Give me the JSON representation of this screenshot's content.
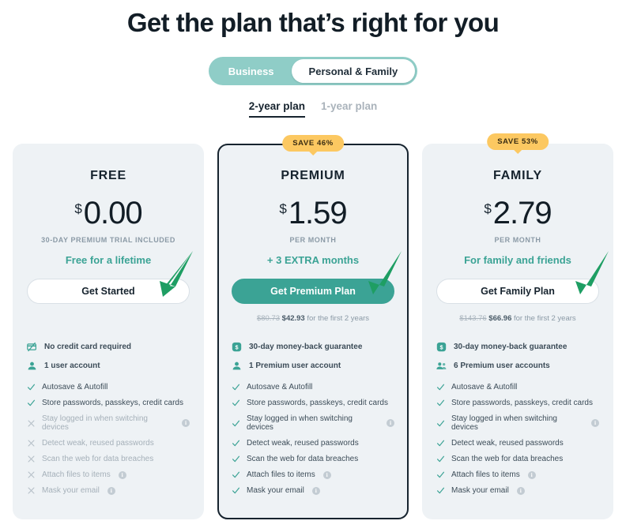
{
  "page": {
    "headline": "Get the plan that’s right for you"
  },
  "audience_toggle": {
    "options": [
      {
        "label": "Business",
        "active": false
      },
      {
        "label": "Personal & Family",
        "active": true
      }
    ]
  },
  "term_tabs": {
    "options": [
      {
        "label": "2-year plan",
        "active": true
      },
      {
        "label": "1-year plan",
        "active": false
      }
    ]
  },
  "colors": {
    "teal": "#3ba395",
    "teal_light": "#8fcdc7",
    "badge": "#fcc861",
    "card_bg": "#eef2f5",
    "ink": "#16232e",
    "muted": "#8b9aa6",
    "arrow_green": "#1e9e63"
  },
  "plans": [
    {
      "name": "FREE",
      "badge": "",
      "currency": "$",
      "amount": "0.00",
      "sub_note": "30-DAY PREMIUM TRIAL INCLUDED",
      "tagline": "Free for a lifetime",
      "cta": "Get Started",
      "cta_style": "ghost",
      "billing": {
        "was": "",
        "now": "",
        "suffix": ""
      },
      "highlights": [
        {
          "icon": "no-credit-card-icon",
          "label": "No credit card required"
        },
        {
          "icon": "single-user-icon",
          "label": "1 user account"
        }
      ],
      "features": [
        {
          "label": "Autosave & Autofill",
          "included": true,
          "info": false
        },
        {
          "label": "Store passwords, passkeys, credit cards",
          "included": true,
          "info": false
        },
        {
          "label": "Stay logged in when switching devices",
          "included": false,
          "info": true
        },
        {
          "label": "Detect weak, reused passwords",
          "included": false,
          "info": false
        },
        {
          "label": "Scan the web for data breaches",
          "included": false,
          "info": false
        },
        {
          "label": "Attach files to items",
          "included": false,
          "info": true
        },
        {
          "label": "Mask your email",
          "included": false,
          "info": true
        }
      ]
    },
    {
      "name": "PREMIUM",
      "badge": "SAVE 46%",
      "currency": "$",
      "amount": "1.59",
      "sub_note": "PER MONTH",
      "tagline": "+ 3 EXTRA months",
      "cta": "Get Premium Plan",
      "cta_style": "solid",
      "billing": {
        "was": "$80.73",
        "now": "$42.93",
        "suffix": "for the first 2 years"
      },
      "highlights": [
        {
          "icon": "money-back-icon",
          "label": "30-day money-back guarantee"
        },
        {
          "icon": "single-user-icon",
          "label": "1 Premium user account"
        }
      ],
      "features": [
        {
          "label": "Autosave & Autofill",
          "included": true,
          "info": false
        },
        {
          "label": "Store passwords, passkeys, credit cards",
          "included": true,
          "info": false
        },
        {
          "label": "Stay logged in when switching devices",
          "included": true,
          "info": true
        },
        {
          "label": "Detect weak, reused passwords",
          "included": true,
          "info": false
        },
        {
          "label": "Scan the web for data breaches",
          "included": true,
          "info": false
        },
        {
          "label": "Attach files to items",
          "included": true,
          "info": true
        },
        {
          "label": "Mask your email",
          "included": true,
          "info": true
        }
      ]
    },
    {
      "name": "FAMILY",
      "badge": "SAVE 53%",
      "currency": "$",
      "amount": "2.79",
      "sub_note": "PER MONTH",
      "tagline": "For family and friends",
      "cta": "Get Family Plan",
      "cta_style": "ghost",
      "billing": {
        "was": "$143.76",
        "now": "$66.96",
        "suffix": "for the first 2 years"
      },
      "highlights": [
        {
          "icon": "money-back-icon",
          "label": "30-day money-back guarantee"
        },
        {
          "icon": "multi-user-icon",
          "label": "6 Premium user accounts"
        }
      ],
      "features": [
        {
          "label": "Autosave & Autofill",
          "included": true,
          "info": false
        },
        {
          "label": "Store passwords, passkeys, credit cards",
          "included": true,
          "info": false
        },
        {
          "label": "Stay logged in when switching devices",
          "included": true,
          "info": true
        },
        {
          "label": "Detect weak, reused passwords",
          "included": true,
          "info": false
        },
        {
          "label": "Scan the web for data breaches",
          "included": true,
          "info": false
        },
        {
          "label": "Attach files to items",
          "included": true,
          "info": true
        },
        {
          "label": "Mask your email",
          "included": true,
          "info": true
        }
      ]
    }
  ],
  "annotations": [
    {
      "name": "annotation-arrow-free",
      "target": "Get Started"
    },
    {
      "name": "annotation-arrow-premium",
      "target": "Get Premium Plan"
    },
    {
      "name": "annotation-arrow-family",
      "target": "Get Family Plan"
    }
  ]
}
